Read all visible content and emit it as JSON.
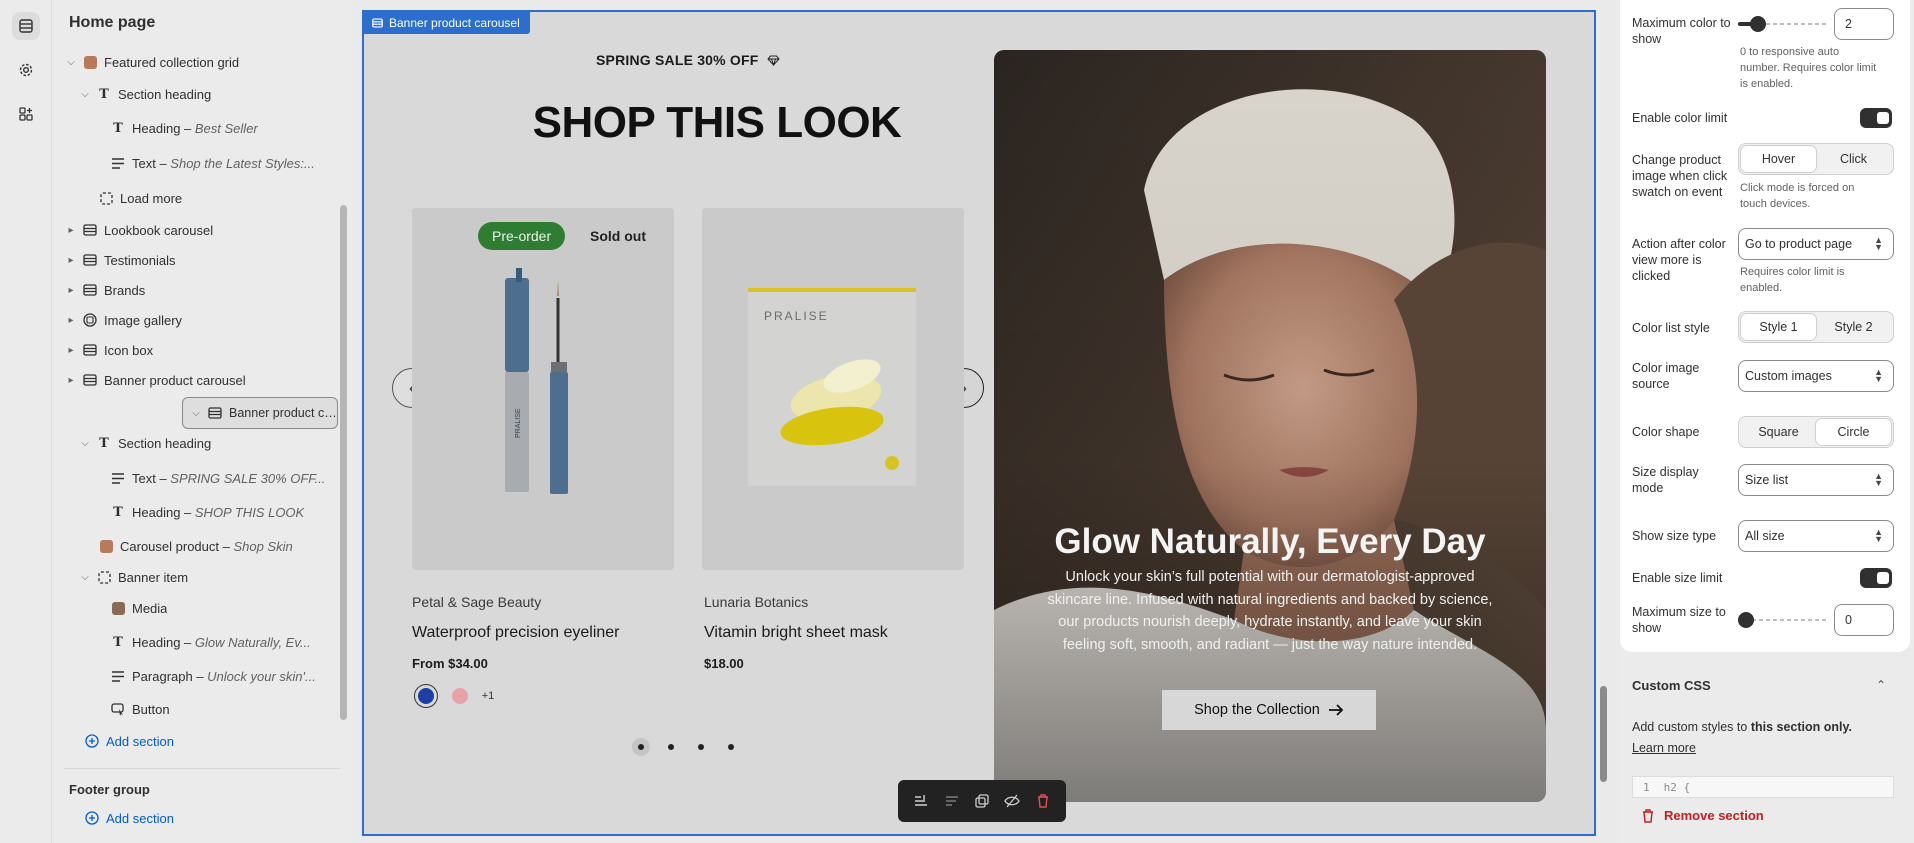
{
  "sidebar": {
    "title": "Home page",
    "rows": [
      {
        "label": "Featured collection grid",
        "detail": ""
      },
      {
        "label": "Section heading",
        "detail": ""
      },
      {
        "label": "Heading – ",
        "detail": "Best Seller"
      },
      {
        "label": "Text – ",
        "detail": "Shop the Latest Styles:..."
      },
      {
        "label": "Load more",
        "detail": ""
      },
      {
        "label": "Lookbook carousel",
        "detail": ""
      },
      {
        "label": "Testimonials",
        "detail": ""
      },
      {
        "label": "Brands",
        "detail": ""
      },
      {
        "label": "Image gallery",
        "detail": ""
      },
      {
        "label": "Icon box",
        "detail": ""
      },
      {
        "label": "Banner product carousel",
        "detail": ""
      },
      {
        "label": "Banner product carousel",
        "detail": ""
      },
      {
        "label": "Section heading",
        "detail": ""
      },
      {
        "label": "Text – ",
        "detail": "SPRING SALE 30% OFF..."
      },
      {
        "label": "Heading – ",
        "detail": "SHOP THIS LOOK"
      },
      {
        "label": "Carousel product – ",
        "detail": "Shop Skin"
      },
      {
        "label": "Banner item",
        "detail": ""
      },
      {
        "label": "Media",
        "detail": ""
      },
      {
        "label": "Heading – ",
        "detail": "Glow Naturally, Ev..."
      },
      {
        "label": "Paragraph – ",
        "detail": "Unlock your skin'..."
      },
      {
        "label": "Button",
        "detail": ""
      }
    ],
    "add_section": "Add section",
    "footer_group": "Footer group",
    "footer_add_section": "Add section"
  },
  "preview": {
    "tag": "Banner product carousel",
    "sale_text": "SPRING SALE 30% OFF",
    "title": "SHOP THIS LOOK",
    "badges": {
      "preorder": "Pre-order",
      "soldout": "Sold out"
    },
    "products": [
      {
        "brand": "Petal & Sage Beauty",
        "name": "Waterproof precision eyeliner",
        "price": "From $34.00",
        "img_text": "PRALISE"
      },
      {
        "brand": "Lunaria Botanics",
        "name": "Vitamin bright sheet mask",
        "price": "$18.00",
        "img_text": "PRALISE"
      }
    ],
    "swatch_more": "+1",
    "hero": {
      "title": "Glow Naturally, Every Day",
      "paragraph": "Unlock your skin’s full potential with our dermatologist-approved skincare line. Infused with natural ingredients and backed by science, our products nourish deeply, hydrate instantly, and leave your skin feeling soft, smooth, and radiant — just the way nature intended.",
      "button": "Shop the Collection"
    }
  },
  "settings": {
    "max_color_label": "Maximum color to show",
    "max_color_value": "2",
    "max_color_help": "0 to responsive auto number. Requires color limit is enabled.",
    "enable_color_limit": "Enable color limit",
    "change_image_label": "Change product image when click swatch on event",
    "change_image_options": [
      "Hover",
      "Click"
    ],
    "change_image_help": "Click mode is forced on touch devices.",
    "action_label": "Action after color view more is clicked",
    "action_value": "Go to product page",
    "action_help": "Requires color limit is enabled.",
    "color_list_style_label": "Color list style",
    "color_list_style_options": [
      "Style 1",
      "Style 2"
    ],
    "color_image_source_label": "Color image source",
    "color_image_source_value": "Custom images",
    "color_shape_label": "Color shape",
    "color_shape_options": [
      "Square",
      "Circle"
    ],
    "size_display_label": "Size display mode",
    "size_display_value": "Size list",
    "show_size_type_label": "Show size type",
    "show_size_type_value": "All size",
    "enable_size_limit": "Enable size limit",
    "max_size_label": "Maximum size to show",
    "max_size_value": "0",
    "custom_css_title": "Custom CSS",
    "custom_css_desc_prefix": "Add custom styles to ",
    "custom_css_desc_bold": "this section only.",
    "learn_more": "Learn more",
    "code_line_no": "1",
    "code_text": "h2 {",
    "remove_section": "Remove section"
  },
  "colors": {
    "accent": "#2c6ecb",
    "preorder_badge": "#2e7d32",
    "danger": "#c41e1e",
    "link": "#005bd3"
  }
}
